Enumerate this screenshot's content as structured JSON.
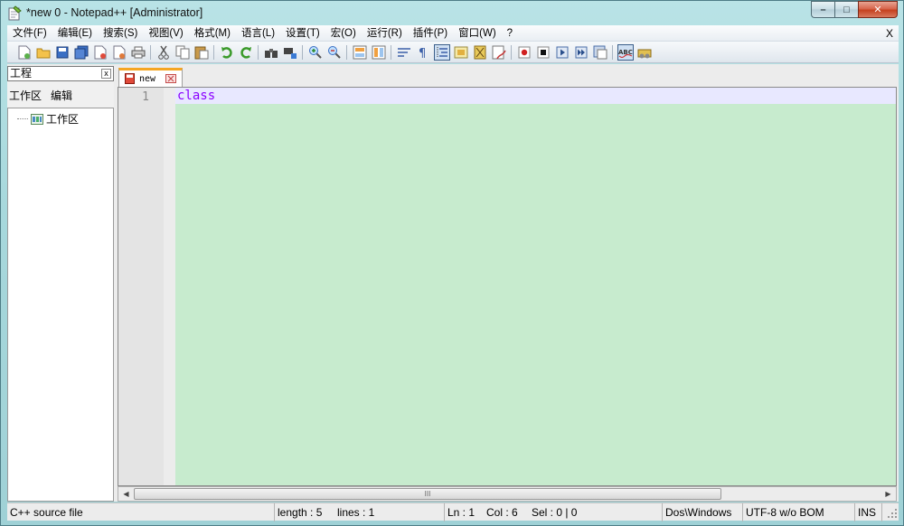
{
  "window": {
    "title": "*new  0 - Notepad++ [Administrator]",
    "minimize_label": "–",
    "maximize_label": "□",
    "close_label": "✕"
  },
  "menu": {
    "items": [
      "文件(F)",
      "编辑(E)",
      "搜索(S)",
      "视图(V)",
      "格式(M)",
      "语言(L)",
      "设置(T)",
      "宏(O)",
      "运行(R)",
      "插件(P)",
      "窗口(W)",
      "?"
    ],
    "close_label": "X"
  },
  "toolbar": {
    "buttons": [
      "new-file-icon",
      "open-file-icon",
      "save-icon",
      "save-all-icon",
      "close-icon",
      "close-all-icon",
      "print-icon",
      "cut-icon",
      "copy-icon",
      "paste-icon",
      "undo-icon",
      "redo-icon",
      "find-icon",
      "replace-icon",
      "zoom-in-icon",
      "zoom-out-icon",
      "sync-vertical-icon",
      "sync-horizontal-icon",
      "word-wrap-icon",
      "show-all-chars-icon",
      "indent-guide-icon",
      "user-lang-icon",
      "doc-map-icon",
      "function-list-icon",
      "record-macro-icon",
      "stop-record-icon",
      "play-macro-icon",
      "run-macro-multiple-icon",
      "save-macro-icon",
      "spell-check-icon",
      "plugin-icon"
    ]
  },
  "project_panel": {
    "title": "工程",
    "close_label": "x",
    "menu": [
      "工作区",
      "编辑"
    ],
    "tree_root": "工作区"
  },
  "tabs": [
    {
      "label": "new",
      "active": true
    }
  ],
  "editor": {
    "line_number": "1",
    "content": "class",
    "background": "#c7ebce",
    "keyword_color": "#8a00ff"
  },
  "hscroll": {
    "thumb_label": "III"
  },
  "status": {
    "file_type": "C++ source file",
    "length": "length : 5",
    "lines": "lines : 1",
    "ln": "Ln : 1",
    "col": "Col : 6",
    "sel": "Sel : 0 | 0",
    "eol": "Dos\\Windows",
    "encoding": "UTF-8 w/o BOM",
    "mode": "INS"
  }
}
